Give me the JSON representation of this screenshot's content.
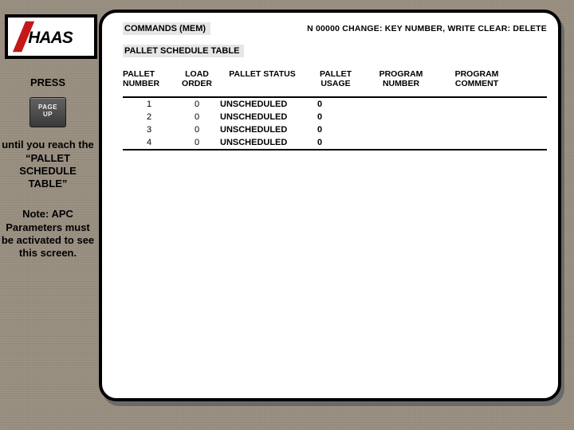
{
  "sidebar": {
    "logo_text": "HAAS",
    "press": "PRESS",
    "key_line1": "PAGE",
    "key_line2": "UP",
    "until": "until you reach  the “PALLET SCHEDULE TABLE”",
    "note": "Note: APC Parameters must be activated to see this screen."
  },
  "panel": {
    "top_left": "COMMANDS (MEM)",
    "top_right": "N 00000 CHANGE: KEY NUMBER,  WRITE   CLEAR: DELETE",
    "subtitle": "PALLET SCHEDULE TABLE",
    "headers": {
      "pallet_number": "PALLET NUMBER",
      "load_order": "LOAD ORDER",
      "pallet_status": "PALLET STATUS",
      "pallet_usage": "PALLET USAGE",
      "program_number": "PROGRAM NUMBER",
      "program_comment": "PROGRAM COMMENT"
    },
    "rows": [
      {
        "pallet_number": "1",
        "load_order": "0",
        "status": "UNSCHEDULED",
        "usage": "0",
        "program_number": "",
        "program_comment": ""
      },
      {
        "pallet_number": "2",
        "load_order": "0",
        "status": "UNSCHEDULED",
        "usage": "0",
        "program_number": "",
        "program_comment": ""
      },
      {
        "pallet_number": "3",
        "load_order": "0",
        "status": "UNSCHEDULED",
        "usage": "0",
        "program_number": "",
        "program_comment": ""
      },
      {
        "pallet_number": "4",
        "load_order": "0",
        "status": "UNSCHEDULED",
        "usage": "0",
        "program_number": "",
        "program_comment": ""
      }
    ]
  }
}
